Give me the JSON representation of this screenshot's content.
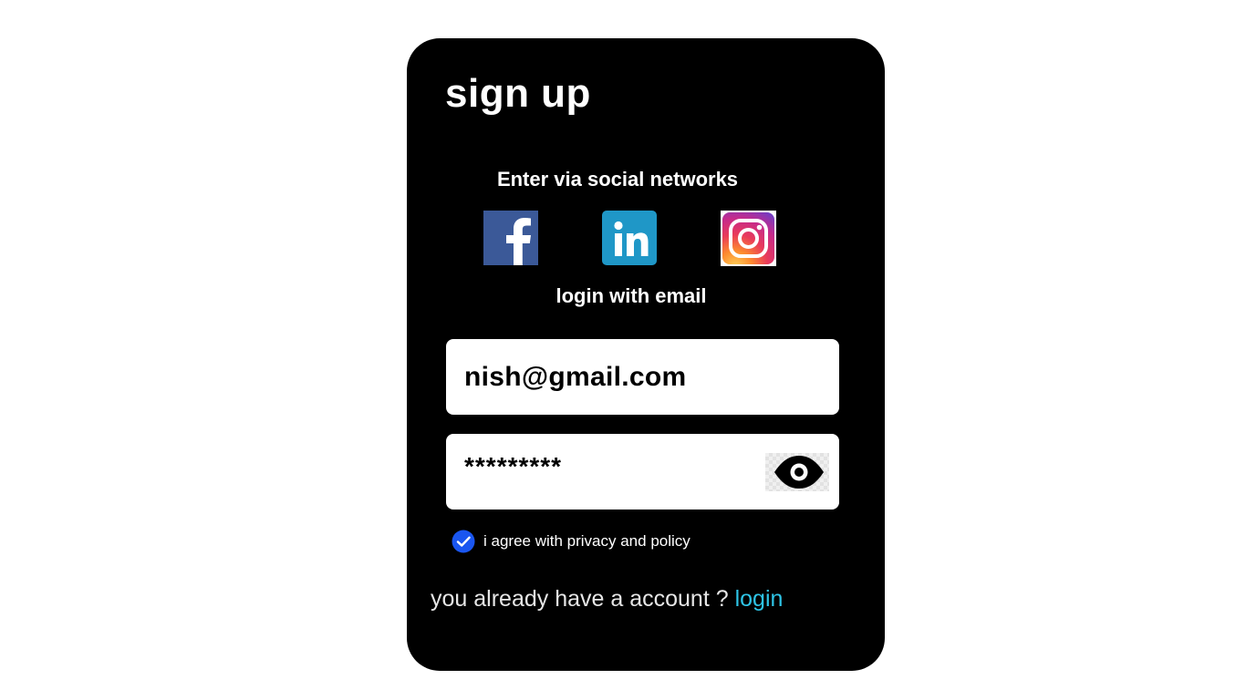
{
  "title": "sign up",
  "social": {
    "heading": "Enter via social networks",
    "networks": [
      {
        "name": "facebook",
        "icon": "facebook-icon",
        "color": "#3b5998"
      },
      {
        "name": "linkedin",
        "icon": "linkedin-icon",
        "color": "#1f97c7"
      },
      {
        "name": "instagram",
        "icon": "instagram-icon",
        "color": "#e1306c"
      }
    ]
  },
  "email_section": {
    "heading": "login with email"
  },
  "form": {
    "email_value": "nish@gmail.com",
    "password_value": "*********",
    "password_toggle_icon": "eye-icon"
  },
  "agree": {
    "checked": true,
    "label": "i agree with privacy and policy",
    "check_color": "#1a56f0"
  },
  "account": {
    "text": "you already have a account ?",
    "link_label": "login",
    "link_color": "#2ec4e6"
  }
}
